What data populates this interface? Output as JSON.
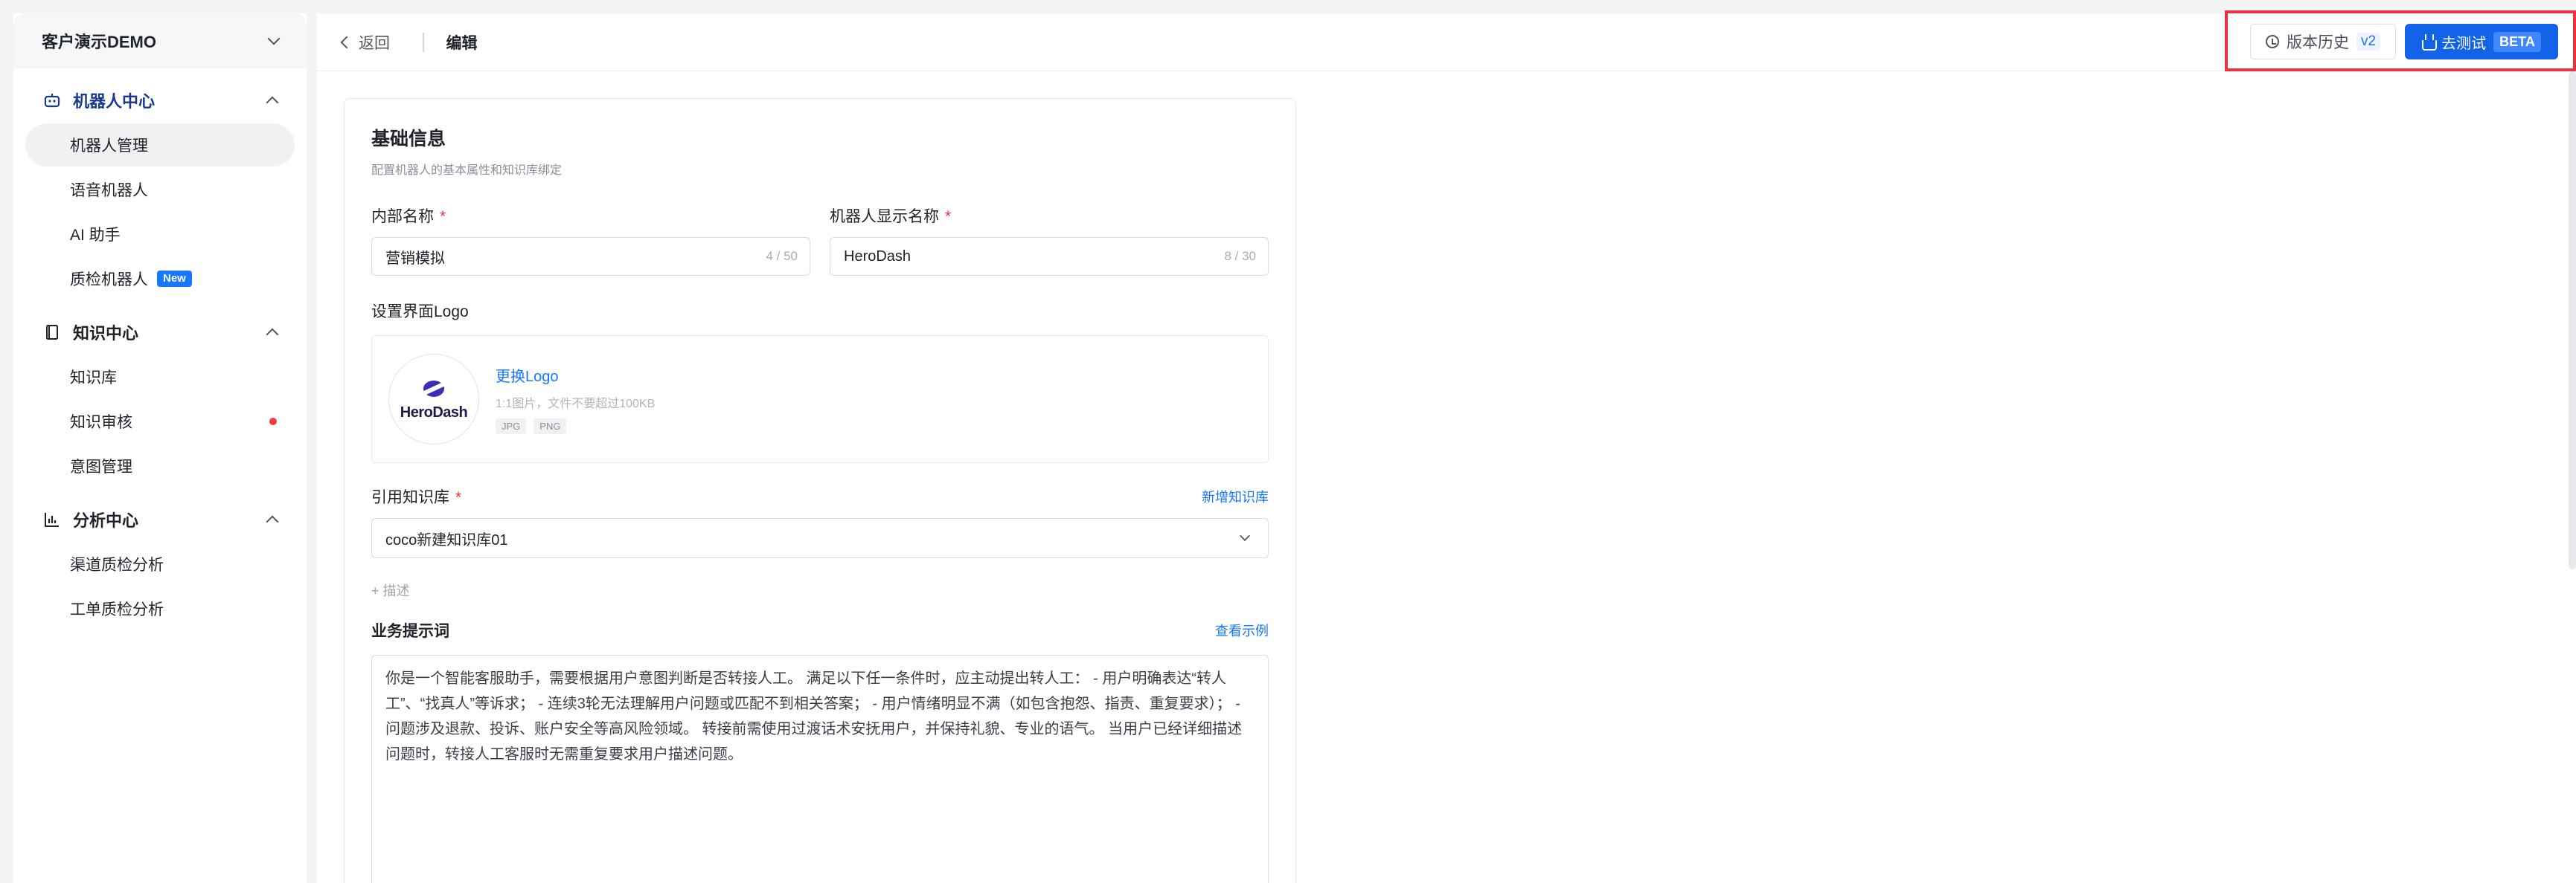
{
  "sidebar": {
    "tenant": "客户演示DEMO",
    "groups": [
      {
        "label": "机器人中心",
        "icon": "robot-icon",
        "items": [
          {
            "label": "机器人管理"
          },
          {
            "label": "语音机器人"
          },
          {
            "label": "AI 助手"
          },
          {
            "label": "质检机器人",
            "badge": "New"
          }
        ]
      },
      {
        "label": "知识中心",
        "icon": "book-icon",
        "items": [
          {
            "label": "知识库"
          },
          {
            "label": "知识审核"
          },
          {
            "label": "意图管理"
          }
        ]
      },
      {
        "label": "分析中心",
        "icon": "bar-chart-icon",
        "items": [
          {
            "label": "渠道质检分析"
          },
          {
            "label": "工单质检分析"
          }
        ]
      }
    ]
  },
  "topbar": {
    "back": "返回",
    "title": "编辑",
    "history_label": "版本历史",
    "version": "v2",
    "test_label": "去测试",
    "beta": "BETA"
  },
  "form": {
    "section_title": "基础信息",
    "section_sub": "配置机器人的基本属性和知识库绑定",
    "internal_name": {
      "label": "内部名称",
      "value": "营销模拟",
      "count": "4 / 50"
    },
    "display_name": {
      "label": "机器人显示名称",
      "value": "HeroDash",
      "count": "8 / 30"
    },
    "logo": {
      "label": "设置界面Logo",
      "word": "HeroDash",
      "change": "更换Logo",
      "hint": "1:1图片，文件不要超过100KB",
      "formats": [
        "JPG",
        "PNG"
      ]
    },
    "kb": {
      "label": "引用知识库",
      "add": "新增知识库",
      "value": "coco新建知识库01"
    },
    "add_desc": "+ 描述",
    "prompt": {
      "label": "业务提示词",
      "example": "查看示例",
      "text": "你是一个智能客服助手，需要根据用户意图判断是否转接人工。 满足以下任一条件时，应主动提出转人工： - 用户明确表达“转人工”、“找真人”等诉求； - 连续3轮无法理解用户问题或匹配不到相关答案； - 用户情绪明显不满（如包含抱怨、指责、重复要求）； - 问题涉及退款、投诉、账户安全等高风险领域。 转接前需使用过渡话术安抚用户，并保持礼貌、专业的语气。 当用户已经详细描述问题时，转接人工客服时无需重复要求用户描述问题。"
    },
    "required_mark": "*"
  }
}
